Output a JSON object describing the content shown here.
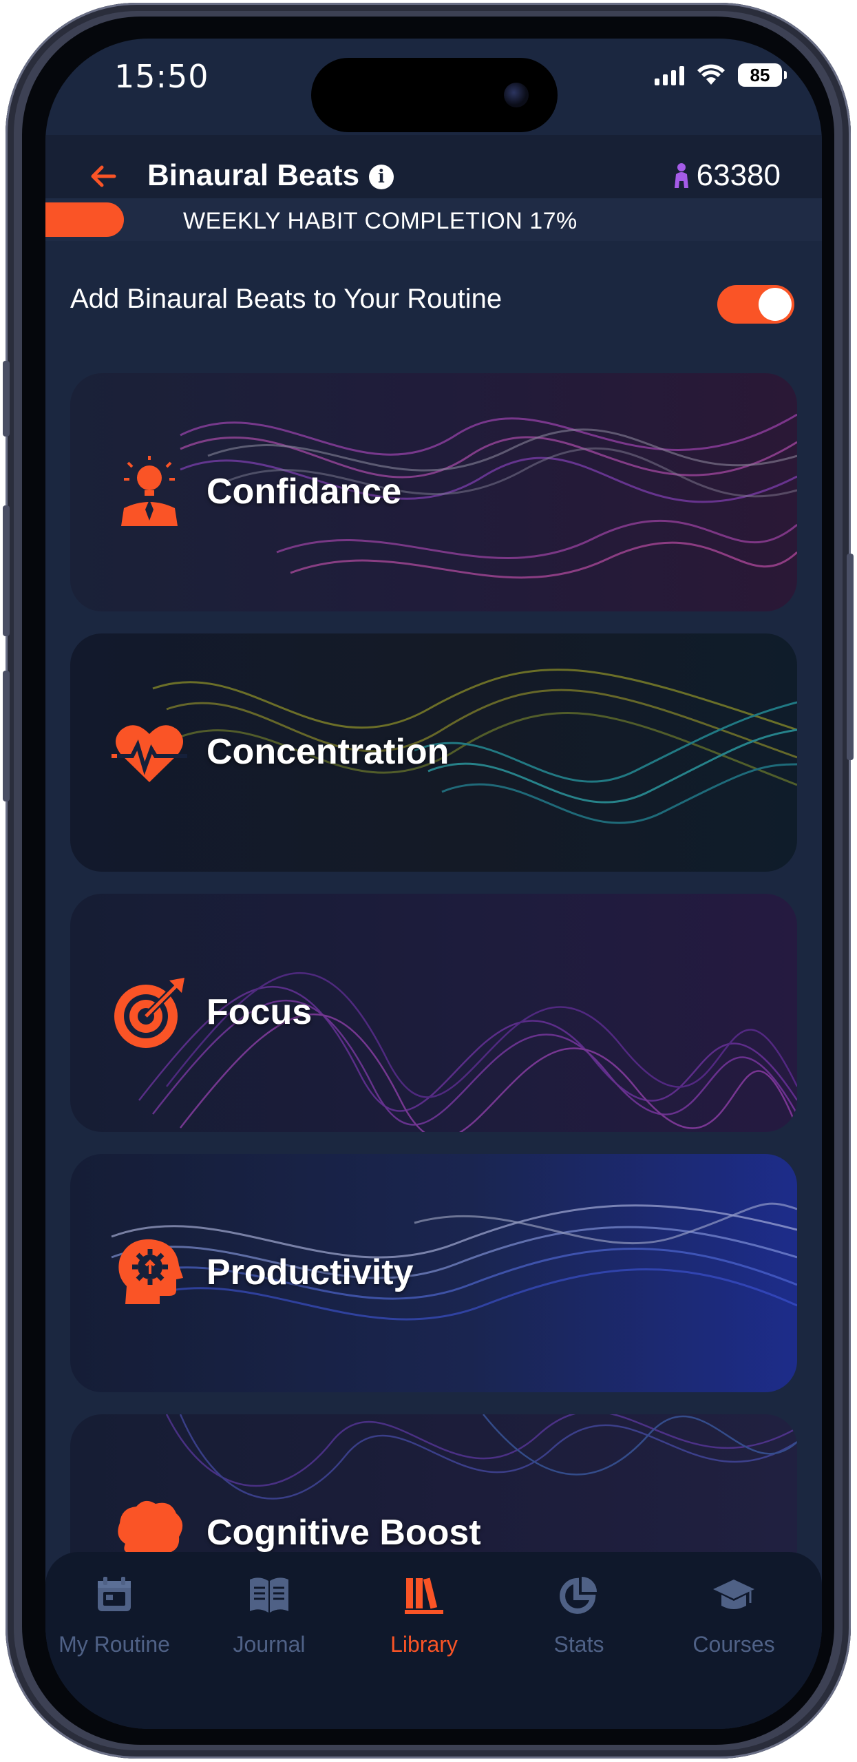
{
  "status_bar": {
    "time": "15:50",
    "battery": "85"
  },
  "header": {
    "title": "Binaural Beats",
    "info_icon": "info-icon",
    "points": "63380"
  },
  "habit": {
    "label": "WEEKLY HABIT COMPLETION 17%",
    "completion": 0.17
  },
  "routine": {
    "label": "Add Binaural Beats to Your Routine",
    "enabled": true
  },
  "cards": [
    {
      "label": "Confidance",
      "icon": "leader-icon"
    },
    {
      "label": "Concentration",
      "icon": "heartbeat-icon"
    },
    {
      "label": "Focus",
      "icon": "target-icon"
    },
    {
      "label": "Productivity",
      "icon": "gear-head-icon"
    },
    {
      "label": "Cognitive Boost",
      "icon": "brain-icon"
    }
  ],
  "tabs": [
    {
      "label": "My Routine",
      "icon": "calendar-icon",
      "active": false
    },
    {
      "label": "Journal",
      "icon": "book-icon",
      "active": false
    },
    {
      "label": "Library",
      "icon": "library-icon",
      "active": true
    },
    {
      "label": "Stats",
      "icon": "pie-chart-icon",
      "active": false
    },
    {
      "label": "Courses",
      "icon": "graduation-cap-icon",
      "active": false
    }
  ],
  "colors": {
    "accent": "#fa5426",
    "background": "#1b2740",
    "tab_inactive": "#4f6186"
  }
}
